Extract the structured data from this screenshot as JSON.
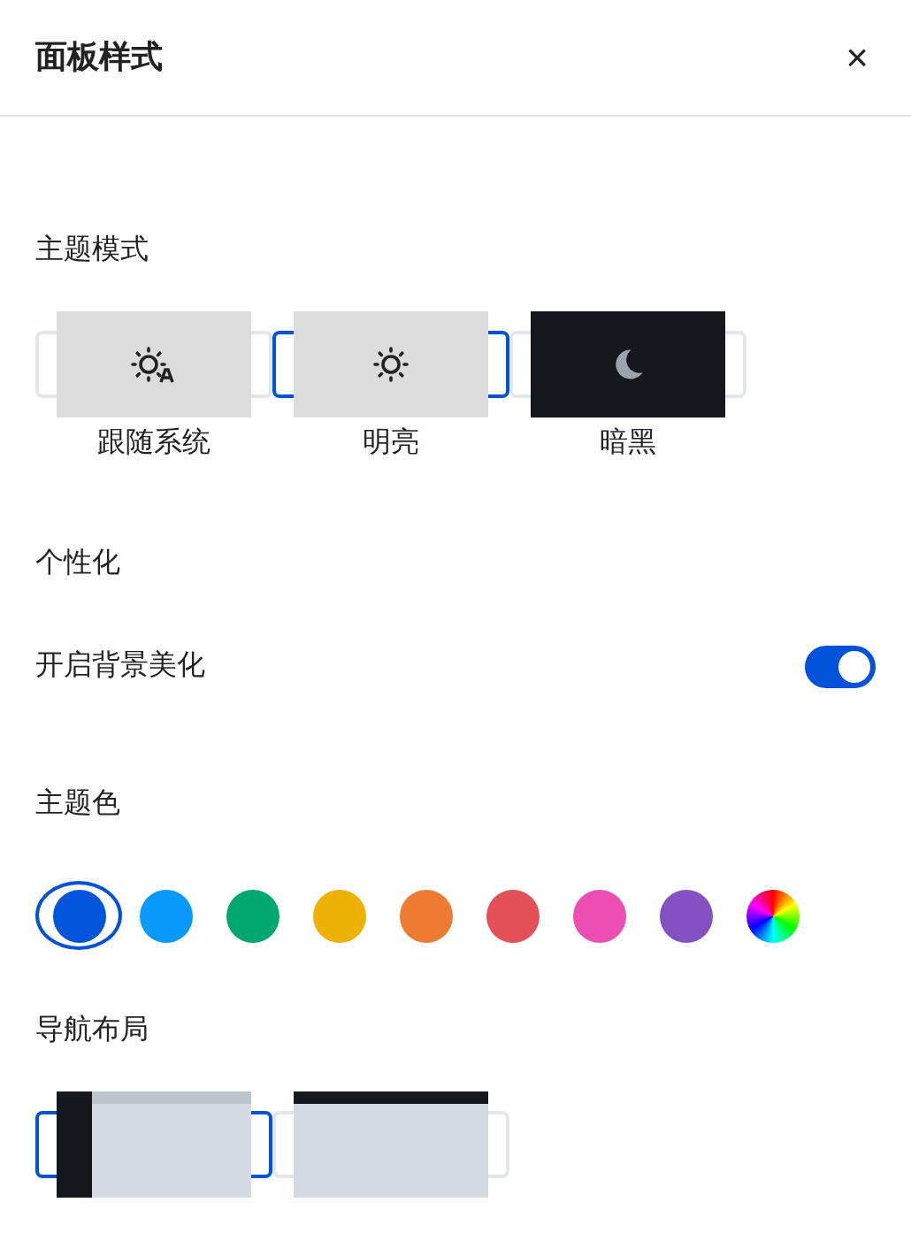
{
  "title": "面板样式",
  "close": "×",
  "theme_section": "主题模式",
  "theme_modes": [
    {
      "label": "跟随系统",
      "kind": "auto",
      "selected": false
    },
    {
      "label": "明亮",
      "kind": "light",
      "selected": true
    },
    {
      "label": "暗黑",
      "kind": "dark",
      "selected": false
    }
  ],
  "personal_section": "个性化",
  "background_toggle": {
    "label": "开启背景美化",
    "on": true
  },
  "color_section": "主题色",
  "colors": [
    {
      "kind": "solid",
      "color": "#0055d9",
      "selected": true
    },
    {
      "kind": "solid",
      "color": "#0999fb",
      "selected": false
    },
    {
      "kind": "solid",
      "color": "#00a870",
      "selected": false
    },
    {
      "kind": "solid",
      "color": "#edb205",
      "selected": false
    },
    {
      "kind": "solid",
      "color": "#ed7b31",
      "selected": false
    },
    {
      "kind": "solid",
      "color": "#e3505a",
      "selected": false
    },
    {
      "kind": "solid",
      "color": "#ed4eb3",
      "selected": false
    },
    {
      "kind": "solid",
      "color": "#8451c2",
      "selected": false
    },
    {
      "kind": "custom",
      "selected": false
    }
  ],
  "nav_section": "导航布局",
  "layouts": [
    {
      "kind": "side",
      "selected": true
    },
    {
      "kind": "top",
      "selected": false
    }
  ]
}
